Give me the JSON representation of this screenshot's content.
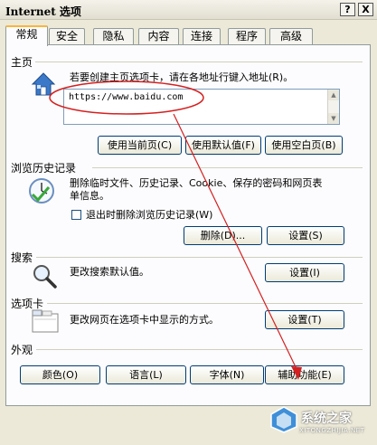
{
  "window": {
    "title": "Internet 选项",
    "help_glyph": "?",
    "close_glyph": "X"
  },
  "tabs": [
    {
      "label": "常规",
      "active": true
    },
    {
      "label": "安全"
    },
    {
      "label": "隐私"
    },
    {
      "label": "内容"
    },
    {
      "label": "连接"
    },
    {
      "label": "程序"
    },
    {
      "label": "高级"
    }
  ],
  "home": {
    "group_label": "主页",
    "hint": "若要创建主页选项卡，请在各地址行键入地址(R)。",
    "url": "https://www.baidu.com",
    "btn_current": "使用当前页(C)",
    "btn_default": "使用默认值(F)",
    "btn_blank": "使用空白页(B)"
  },
  "history": {
    "group_label": "浏览历史记录",
    "description": "删除临时文件、历史记录、Cookie、保存的密码和网页表单信息。",
    "checkbox_label": "退出时删除浏览历史记录(W)",
    "btn_delete": "删除(D)...",
    "btn_settings": "设置(S)"
  },
  "search": {
    "group_label": "搜索",
    "description": "更改搜索默认值。",
    "btn_settings": "设置(I)"
  },
  "tabs_section": {
    "group_label": "选项卡",
    "description": "更改网页在选项卡中显示的方式。",
    "btn_settings": "设置(T)"
  },
  "appearance": {
    "group_label": "外观",
    "btn_colors": "颜色(O)",
    "btn_languages": "语言(L)",
    "btn_fonts": "字体(N)",
    "btn_accessibility": "辅助功能(E)"
  },
  "watermark": {
    "brand": "系统之家",
    "site": "XITONGZHIJIA.NET"
  },
  "colors": {
    "annotation_red": "#d42020",
    "tab_highlight": "#f9b53b",
    "button_border": "#003c74"
  }
}
